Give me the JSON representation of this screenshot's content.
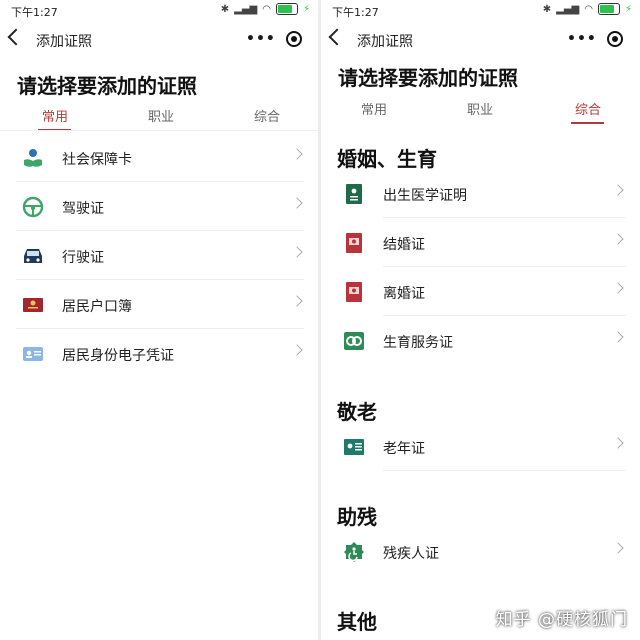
{
  "left": {
    "status_time": "下午1:27",
    "nav_title": "添加证照",
    "page_title": "请选择要添加的证照",
    "tabs": [
      "常用",
      "职业",
      "综合"
    ],
    "items": [
      {
        "label": "社会保障卡",
        "icon": "social-security-card-icon"
      },
      {
        "label": "驾驶证",
        "icon": "steering-wheel-icon"
      },
      {
        "label": "行驶证",
        "icon": "car-icon"
      },
      {
        "label": "居民户口簿",
        "icon": "household-register-icon"
      },
      {
        "label": "居民身份电子凭证",
        "icon": "id-card-icon"
      }
    ]
  },
  "right": {
    "status_time": "下午1:27",
    "nav_title": "添加证照",
    "page_title": "请选择要添加的证照",
    "tabs": [
      "常用",
      "职业",
      "综合"
    ],
    "sections": [
      {
        "title": "婚姻、生育",
        "items": [
          {
            "label": "出生医学证明",
            "icon": "birth-certificate-icon"
          },
          {
            "label": "结婚证",
            "icon": "marriage-certificate-icon"
          },
          {
            "label": "离婚证",
            "icon": "divorce-certificate-icon"
          },
          {
            "label": "生育服务证",
            "icon": "fertility-service-icon"
          }
        ]
      },
      {
        "title": "敬老",
        "items": [
          {
            "label": "老年证",
            "icon": "senior-card-icon"
          }
        ]
      },
      {
        "title": "助残",
        "items": [
          {
            "label": "残疾人证",
            "icon": "disability-card-icon"
          }
        ]
      },
      {
        "title": "其他",
        "items": []
      }
    ]
  },
  "watermark": "知乎 @硬核狐门",
  "colors": {
    "accent": "#b23a3a",
    "battery": "#2bc24d",
    "green_icon": "#2e8b57",
    "red_icon": "#b8333a",
    "blue_icon": "#2f6fb3"
  }
}
